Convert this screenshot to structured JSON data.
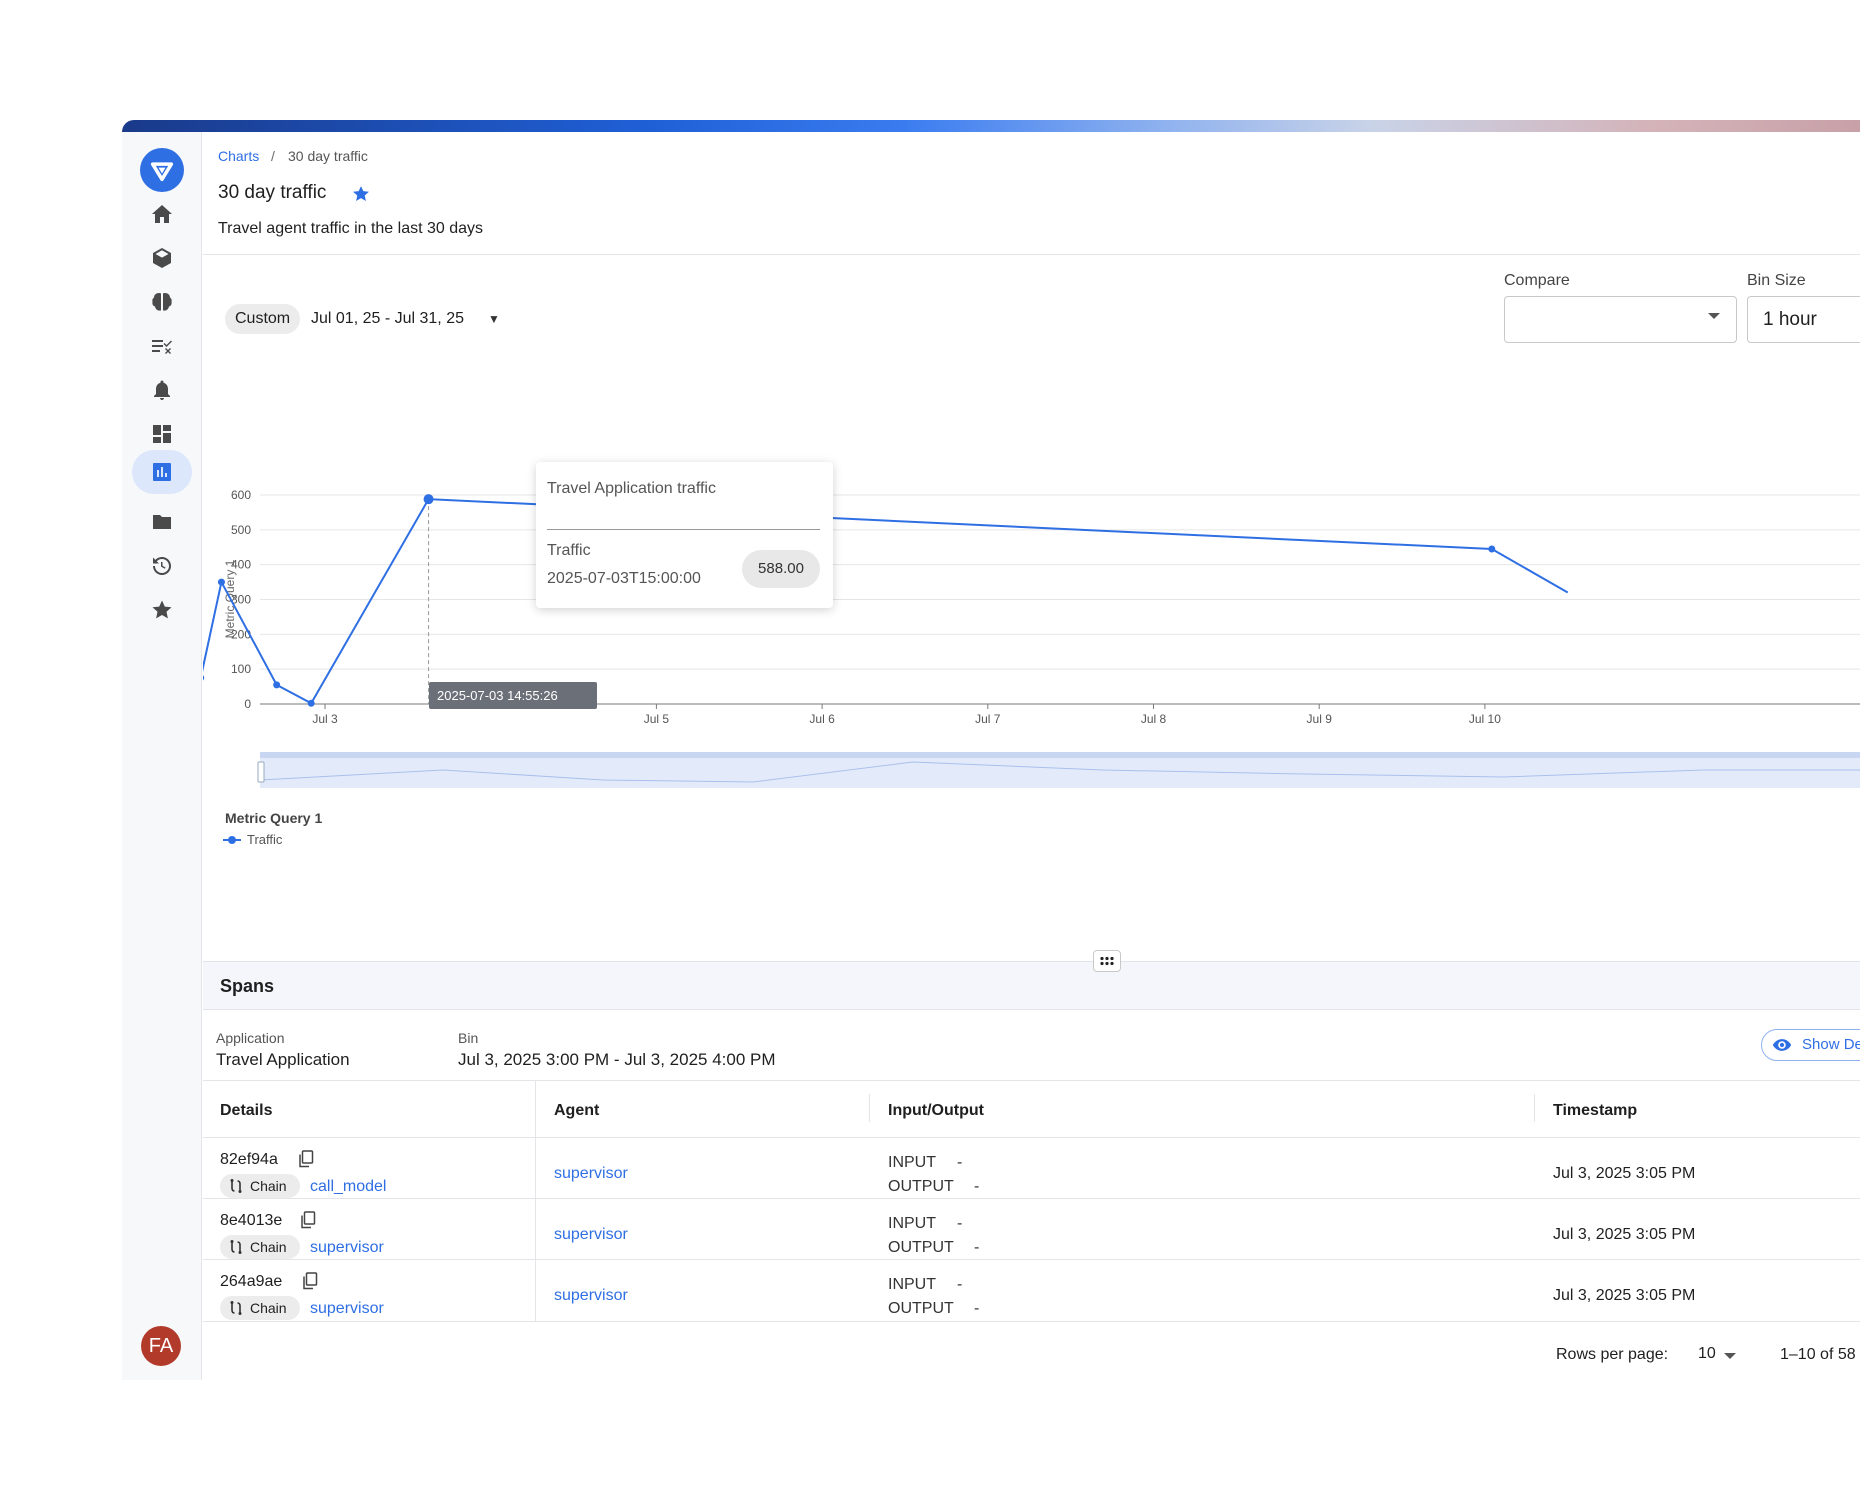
{
  "breadcrumb": {
    "root": "Charts",
    "separator": "/",
    "current": "30 day traffic"
  },
  "page": {
    "title": "30 day traffic",
    "description": "Travel agent traffic in the last 30 days"
  },
  "sidebar": {
    "items": [
      {
        "icon": "home-icon"
      },
      {
        "icon": "cube-icon"
      },
      {
        "icon": "brain-icon"
      },
      {
        "icon": "checklist-icon"
      },
      {
        "icon": "bell-icon"
      },
      {
        "icon": "dashboard-icon"
      },
      {
        "icon": "chart-icon",
        "active": true
      },
      {
        "icon": "folder-icon"
      },
      {
        "icon": "history-icon"
      },
      {
        "icon": "star-icon"
      }
    ],
    "avatar_initials": "FA"
  },
  "filters": {
    "date_mode": "Custom",
    "date_range": "Jul 01, 25 - Jul 31, 25",
    "compare_label": "Compare",
    "compare_value": "",
    "bin_size_label": "Bin Size",
    "bin_size_value": "1 hour"
  },
  "chart_data": {
    "type": "line",
    "ylabel": "Metric Query 1",
    "yticks": [
      0,
      100,
      200,
      300,
      400,
      500,
      600
    ],
    "xticks": [
      "Jul 3",
      "Jul 5",
      "Jul 6",
      "Jul 7",
      "Jul 8",
      "Jul 9",
      "Jul 10"
    ],
    "ylim": [
      0,
      600
    ],
    "legend_title": "Metric Query 1",
    "series": [
      {
        "name": "Traffic",
        "points": [
          {
            "x": "2025-07-02T06:00",
            "y": 75
          },
          {
            "x": "2025-07-02T09:00",
            "y": 350
          },
          {
            "x": "2025-07-02T17:00",
            "y": 55
          },
          {
            "x": "2025-07-02T22:00",
            "y": 2
          },
          {
            "x": "2025-07-03T15:00",
            "y": 588
          },
          {
            "x": "2025-07-10T01:00",
            "y": 445
          },
          {
            "x": "2025-07-10T12:00",
            "y": 320
          }
        ]
      }
    ],
    "color": "#2f6fe4"
  },
  "tooltip": {
    "title": "Travel Application traffic",
    "metric": "Traffic",
    "timestamp": "2025-07-03T15:00:00",
    "value": "588.00"
  },
  "x_cursor_label": "2025-07-03 14:55:26",
  "spans": {
    "title": "Spans",
    "application_label": "Application",
    "application_value": "Travel Application",
    "bin_label": "Bin",
    "bin_value": "Jul 3, 2025 3:00 PM - Jul 3, 2025 4:00 PM",
    "show_details_label": "Show De",
    "columns": [
      "Details",
      "Agent",
      "Input/Output",
      "Timestamp"
    ],
    "rows": [
      {
        "id": "82ef94a",
        "kind": "Chain",
        "name": "call_model",
        "agent": "supervisor",
        "input": "INPUT",
        "input_val": "-",
        "output": "OUTPUT",
        "output_val": "-",
        "timestamp": "Jul 3, 2025 3:05 PM"
      },
      {
        "id": "8e4013e",
        "kind": "Chain",
        "name": "supervisor",
        "agent": "supervisor",
        "input": "INPUT",
        "input_val": "-",
        "output": "OUTPUT",
        "output_val": "-",
        "timestamp": "Jul 3, 2025 3:05 PM"
      },
      {
        "id": "264a9ae",
        "kind": "Chain",
        "name": "supervisor",
        "agent": "supervisor",
        "input": "INPUT",
        "input_val": "-",
        "output": "OUTPUT",
        "output_val": "-",
        "timestamp": "Jul 3, 2025 3:05 PM"
      }
    ],
    "rows_per_page_label": "Rows per page:",
    "rows_per_page_value": "10",
    "page_range": "1–10 of 58"
  }
}
